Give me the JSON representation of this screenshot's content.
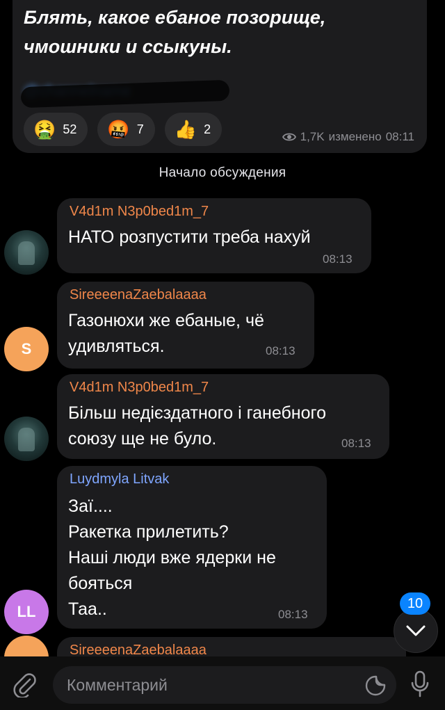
{
  "post": {
    "text_line1": "Блять, какое ебаное позорище,",
    "text_line2": "чмошники и ссыкуны.",
    "hidden_link": "@channelname",
    "reactions": [
      {
        "emoji": "🤮",
        "count": "52"
      },
      {
        "emoji": "🤬",
        "count": "7"
      },
      {
        "emoji": "👍",
        "count": "2"
      }
    ],
    "views": "1,7K",
    "edited_label": "изменено",
    "time": "08:11"
  },
  "divider": "Начало обсуждения",
  "messages": [
    {
      "author": "V4d1m N3p0bed1m_7",
      "author_color": "#f0874a",
      "lines": [
        "НАТО розпустити треба нахуй"
      ],
      "time": "08:13",
      "avatar": "image"
    },
    {
      "author": "SireeeenaZaebalaaaa",
      "author_color": "#f0874a",
      "lines": [
        "Газонюхи же ебаные, чё",
        "удивляться."
      ],
      "time": "08:13",
      "avatar": "S"
    },
    {
      "author": "V4d1m N3p0bed1m_7",
      "author_color": "#f0874a",
      "lines": [
        "Більш недієздатного і ганебного",
        "союзу ще не було."
      ],
      "time": "08:13",
      "avatar": "image"
    },
    {
      "author": "Luydmyla Litvak",
      "author_color": "#7fa6ff",
      "lines": [
        "Заї....",
        "Ракетка прилетить?",
        "Наші люди вже ядерки не",
        "бояться",
        "Таа.."
      ],
      "time": "08:13",
      "avatar": "LL"
    },
    {
      "author": "SireeeenaZaebalaaaa",
      "author_color": "#f0874a",
      "lines": [],
      "time": "",
      "avatar": "S"
    }
  ],
  "unread_count": "10",
  "composer": {
    "placeholder": "Комментарий"
  },
  "colors": {
    "accent": "#0a84ff",
    "bubble": "#1c1c1e",
    "avatar_s": "#f5a35a",
    "avatar_ll": "#c878e8"
  }
}
